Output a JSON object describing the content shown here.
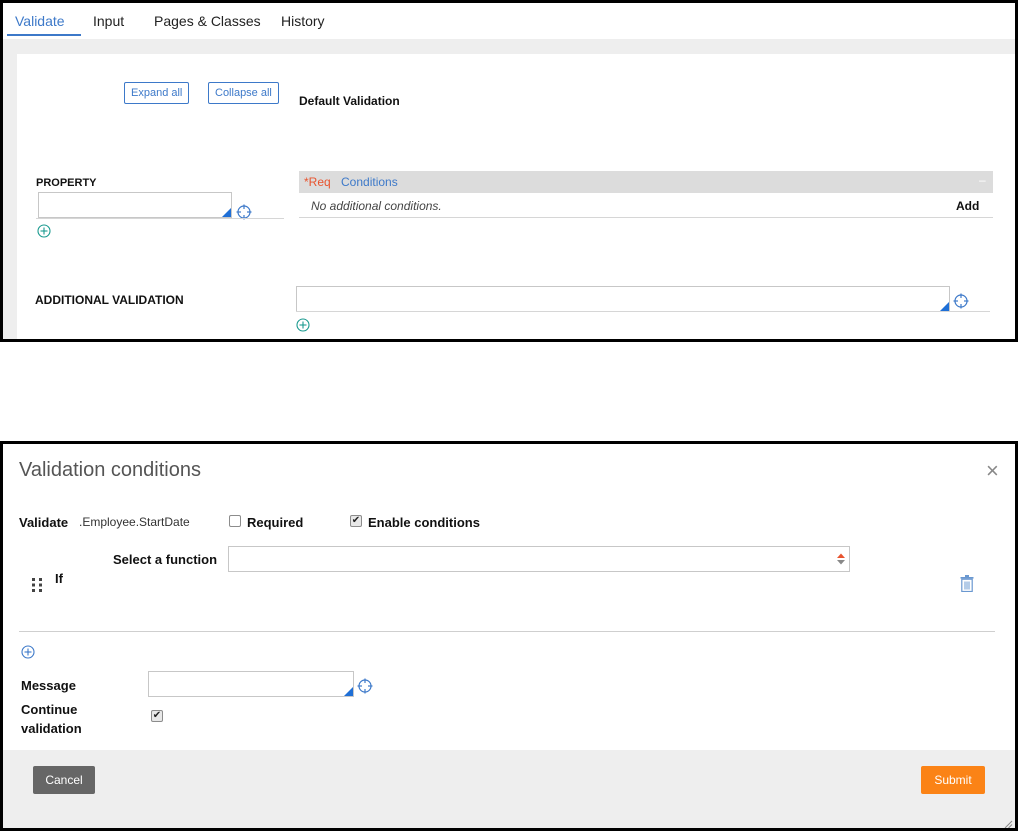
{
  "rule_form": {
    "tabs": [
      {
        "label": "Validate"
      },
      {
        "label": "Input"
      },
      {
        "label": "Pages & Classes"
      },
      {
        "label": "History"
      }
    ],
    "expand_all_label": "Expand all",
    "collapse_all_label": "Collapse all",
    "default_validation_label": "Default Validation",
    "property_label": "PROPERTY",
    "property_value": "",
    "conditions_header": {
      "req_label": "*Req",
      "conditions_label": "Conditions",
      "collapse_glyph": "–"
    },
    "no_conditions_text": "No additional conditions.",
    "add_label": "Add",
    "additional_validation_label": "ADDITIONAL VALIDATION",
    "additional_validation_value": ""
  },
  "dialog": {
    "title": "Validation conditions",
    "close_glyph": "×",
    "validate_label": "Validate",
    "property_path": ".Employee.StartDate",
    "required_label": "Required",
    "required_checked": false,
    "enable_conditions_label": "Enable conditions",
    "enable_conditions_checked": true,
    "select_function_label": "Select a function",
    "select_function_value": "",
    "if_label": "If",
    "message_label": "Message",
    "message_value": "",
    "continue_label_line1": "Continue",
    "continue_label_line2": "validation",
    "continue_checked": true,
    "cancel_label": "Cancel",
    "submit_label": "Submit"
  },
  "icons": {
    "crosshair": "crosshair-icon",
    "add": "plus-circle-icon",
    "drag": "drag-handle-icon",
    "delete": "trash-icon",
    "close": "close-icon",
    "sort": "sort-arrows-icon"
  },
  "colors": {
    "accent_blue": "#3d79c9",
    "required_red": "#e8542f",
    "submit_orange": "#fb8316",
    "cancel_gray": "#666666"
  }
}
